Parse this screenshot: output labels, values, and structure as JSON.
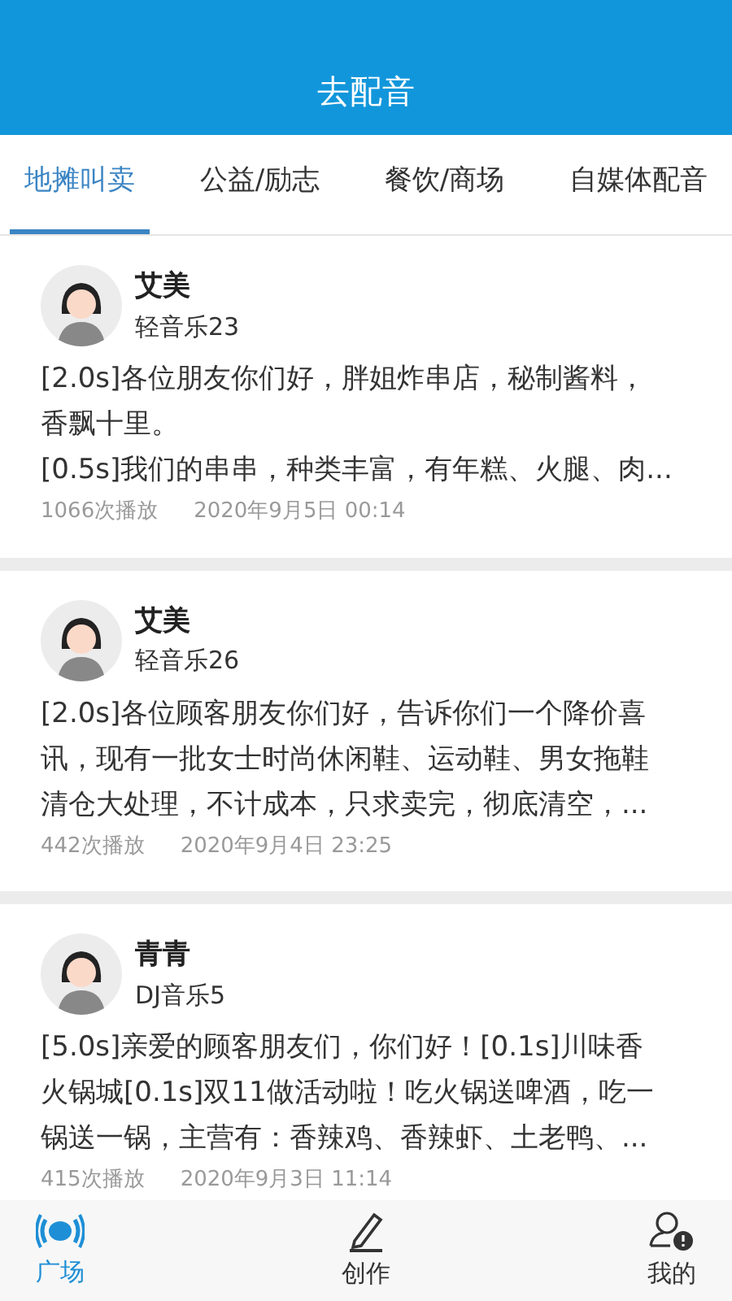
{
  "header": {
    "title": "去配音"
  },
  "tabs": [
    {
      "label": "地摊叫卖",
      "selected": true
    },
    {
      "label": "公益/励志",
      "selected": false
    },
    {
      "label": "餐饮/商场",
      "selected": false
    },
    {
      "label": "自媒体配音",
      "selected": false
    }
  ],
  "posts": [
    {
      "name": "艾美",
      "subtitle": "轻音乐23",
      "lines": [
        "[2.0s]各位朋友你们好，胖姐炸串店，秘制酱料，",
        "香飘十里。",
        "[0.5s]我们的串串，种类丰富，有年糕、火腿、肉..."
      ],
      "plays": "1066次播放",
      "date": "2020年9月5日 00:14"
    },
    {
      "name": "艾美",
      "subtitle": "轻音乐26",
      "lines": [
        "[2.0s]各位顾客朋友你们好，告诉你们一个降价喜",
        "讯，现有一批女士时尚休闲鞋、运动鞋、男女拖鞋",
        "清仓大处理，不计成本，只求卖完，彻底清空，..."
      ],
      "plays": "442次播放",
      "date": "2020年9月4日 23:25"
    },
    {
      "name": "青青",
      "subtitle": "DJ音乐5",
      "lines": [
        "[5.0s]亲爱的顾客朋友们，你们好！[0.1s]川味香",
        "火锅城[0.1s]双11做活动啦！吃火锅送啤酒，吃一",
        "锅送一锅，主营有：香辣鸡、香辣虾、土老鸭、..."
      ],
      "plays": "415次播放",
      "date": "2020年9月3日 11:14"
    }
  ],
  "nav": [
    {
      "kind": "square",
      "label": "广场",
      "selected": true
    },
    {
      "kind": "create",
      "label": "创作",
      "selected": false
    },
    {
      "kind": "profile",
      "label": "我的",
      "selected": false
    }
  ]
}
